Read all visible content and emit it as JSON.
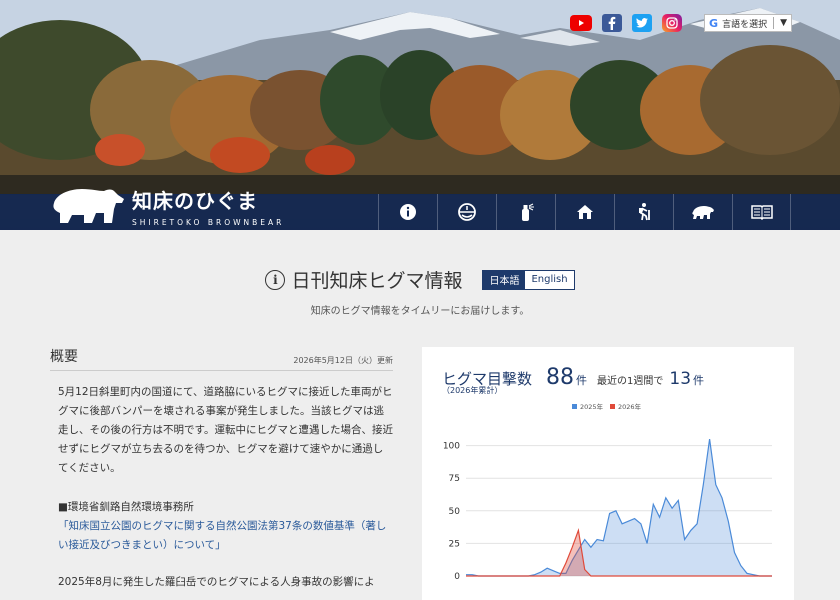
{
  "header": {
    "logo_ja": "知床のひぐま",
    "logo_en": "SHIRETOKO BROWNBEAR",
    "translate_label": "言語を選択",
    "sns": [
      "youtube-icon",
      "facebook-icon",
      "twitter-icon",
      "instagram-icon"
    ],
    "nav": [
      "info-icon",
      "lifebuoy-icon",
      "bear-spray-icon",
      "house-icon",
      "hiker-icon",
      "bear-icon",
      "book-icon"
    ]
  },
  "page": {
    "title": "日刊知床ヒグマ情報",
    "lang_ja": "日本語",
    "lang_en": "English",
    "subtitle": "知床のヒグマ情報をタイムリーにお届けします。"
  },
  "summary": {
    "heading": "概要",
    "date": "2026年5月12日（火）更新",
    "p1": "5月12日斜里町内の国道にて、道路脇にいるヒグマに接近した車両がヒグマに後部バンパーを壊される事案が発生しました。当該ヒグマは逃走し、その後の行方は不明です。運転中にヒグマと遭遇した場合、接近せずにヒグマが立ち去るのを待つか、ヒグマを避けて速やかに通過してください。",
    "org": "■環境省釧路自然環境事務所",
    "link": "「知床国立公園のヒグマに関する自然公園法第37条の数値基準（著しい接近及びつきまとい）について」",
    "p3": "2025年8月に発生した羅臼岳でのヒグマによる人身事故の影響によ"
  },
  "sightings": {
    "title": "ヒグマ目撃数",
    "subtitle": "（2026年累計）",
    "count": "88",
    "unit": "件",
    "week_label": "最近の1週間で",
    "week_count": "13",
    "week_unit": "件"
  },
  "colors": {
    "navy": "#122854",
    "accent": "#1e3a6b",
    "series_2025": "#4a8ad8",
    "series_2026": "#e04a3a"
  },
  "chart_data": {
    "type": "area",
    "legend_position": "top",
    "grid": true,
    "ylim": [
      0,
      125
    ],
    "yticks": [
      "0",
      "25",
      "50",
      "75",
      "100"
    ],
    "series": [
      {
        "name": "2025年",
        "values": [
          1,
          1,
          0,
          0,
          0,
          0,
          0,
          0,
          0,
          0,
          0,
          1,
          3,
          6,
          4,
          2,
          2,
          12,
          20,
          28,
          22,
          28,
          27,
          48,
          50,
          40,
          42,
          44,
          40,
          25,
          55,
          45,
          60,
          52,
          58,
          28,
          35,
          40,
          70,
          105,
          70,
          60,
          42,
          18,
          8,
          2,
          1,
          0,
          0,
          0
        ]
      },
      {
        "name": "2026年",
        "values": [
          0,
          0,
          0,
          0,
          0,
          0,
          0,
          0,
          0,
          0,
          0,
          0,
          0,
          0,
          0,
          0,
          10,
          22,
          35,
          5,
          0,
          0,
          0,
          0,
          0,
          0,
          0,
          0,
          0,
          0,
          0,
          0,
          0,
          0,
          0,
          0,
          0,
          0,
          0,
          0,
          0,
          0,
          0,
          0,
          0,
          0,
          0,
          0,
          0,
          0
        ]
      }
    ]
  }
}
